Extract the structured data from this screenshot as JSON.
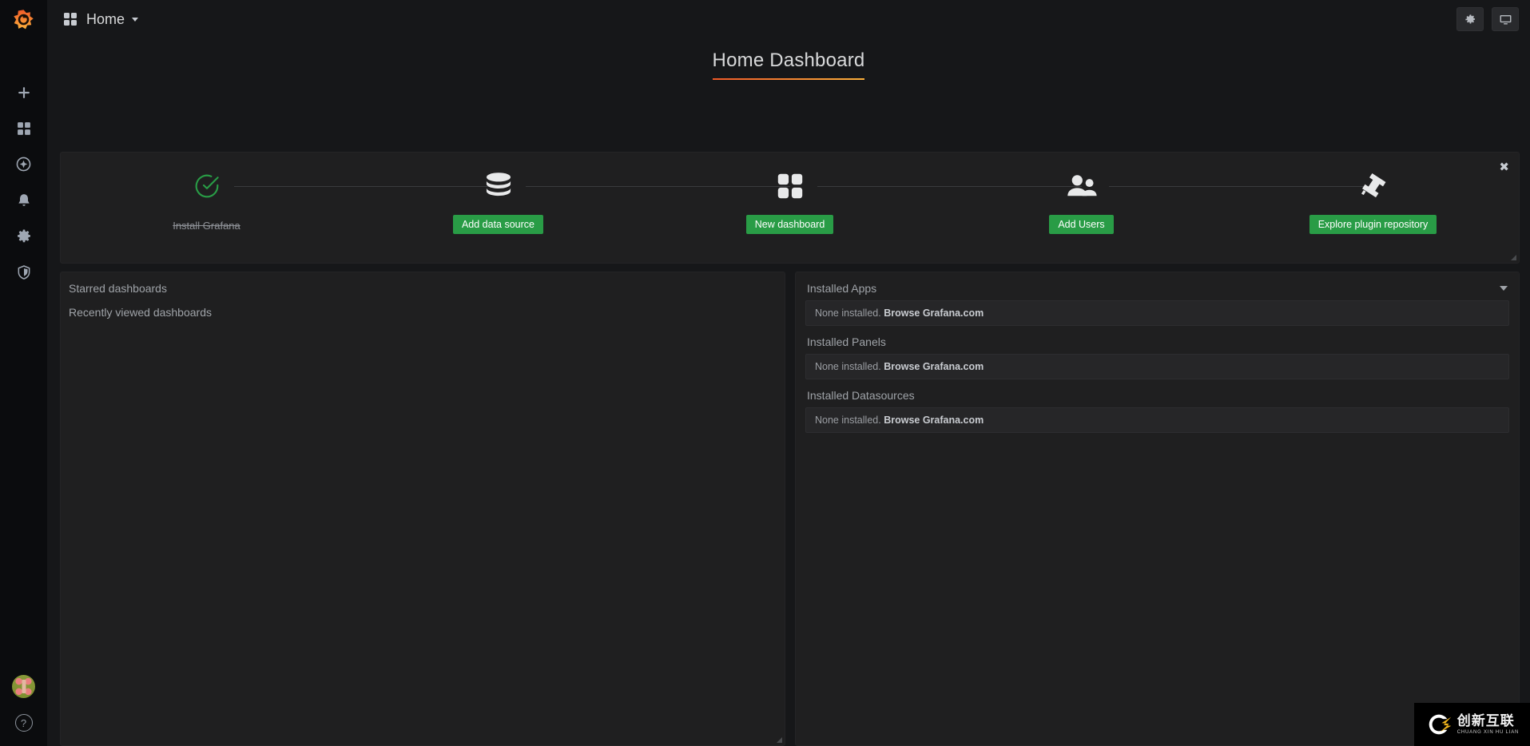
{
  "colors": {
    "accent_green": "#299c46",
    "title_gradient_from": "#f05a28",
    "title_gradient_to": "#fbb03b",
    "app_bg": "#161719",
    "panel_bg": "#1f1f20",
    "sidebar_bg": "#0b0c0e"
  },
  "sidebar": {
    "logo": "grafana-logo-icon",
    "items": [
      {
        "name": "create",
        "icon": "plus-icon"
      },
      {
        "name": "dashboards",
        "icon": "grid-icon"
      },
      {
        "name": "explore",
        "icon": "compass-icon"
      },
      {
        "name": "alerting",
        "icon": "bell-icon"
      },
      {
        "name": "configuration",
        "icon": "gear-icon"
      },
      {
        "name": "server-admin",
        "icon": "shield-icon"
      }
    ],
    "bottom": {
      "avatar": "user-avatar",
      "help": "?"
    }
  },
  "topnav": {
    "breadcrumb": "Home",
    "breadcrumb_icon": "grid-icon",
    "dropdown_icon": "chevron-down-icon",
    "actions": [
      {
        "name": "dashboard-settings",
        "icon": "gear-icon"
      },
      {
        "name": "tv-mode",
        "icon": "monitor-icon"
      }
    ]
  },
  "dashboard": {
    "title": "Home Dashboard"
  },
  "getting_started": {
    "close_label": "✖",
    "steps": [
      {
        "id": "install-grafana",
        "label": "Install Grafana",
        "icon": "check-circle-icon",
        "done": true
      },
      {
        "id": "add-data-source",
        "label": "Add data source",
        "icon": "database-icon",
        "done": false
      },
      {
        "id": "new-dashboard",
        "label": "New dashboard",
        "icon": "grid-icon",
        "done": false
      },
      {
        "id": "add-users",
        "label": "Add Users",
        "icon": "users-icon",
        "done": false
      },
      {
        "id": "explore-plugin-repository",
        "label": "Explore plugin repository",
        "icon": "plug-icon",
        "done": false
      }
    ]
  },
  "dashboards_panel": {
    "starred_title": "Starred dashboards",
    "recent_title": "Recently viewed dashboards"
  },
  "plugins_panel": {
    "sections": [
      {
        "title": "Installed Apps",
        "collapsible": true,
        "caret_icon": "chevron-down-icon",
        "empty_prefix": "None installed.",
        "empty_link": "Browse Grafana.com"
      },
      {
        "title": "Installed Panels",
        "collapsible": false,
        "empty_prefix": "None installed.",
        "empty_link": "Browse Grafana.com"
      },
      {
        "title": "Installed Datasources",
        "collapsible": false,
        "empty_prefix": "None installed.",
        "empty_link": "Browse Grafana.com"
      }
    ]
  },
  "watermark": {
    "cn": "创新互联",
    "en": "CHUANG XIN HU LIAN"
  }
}
